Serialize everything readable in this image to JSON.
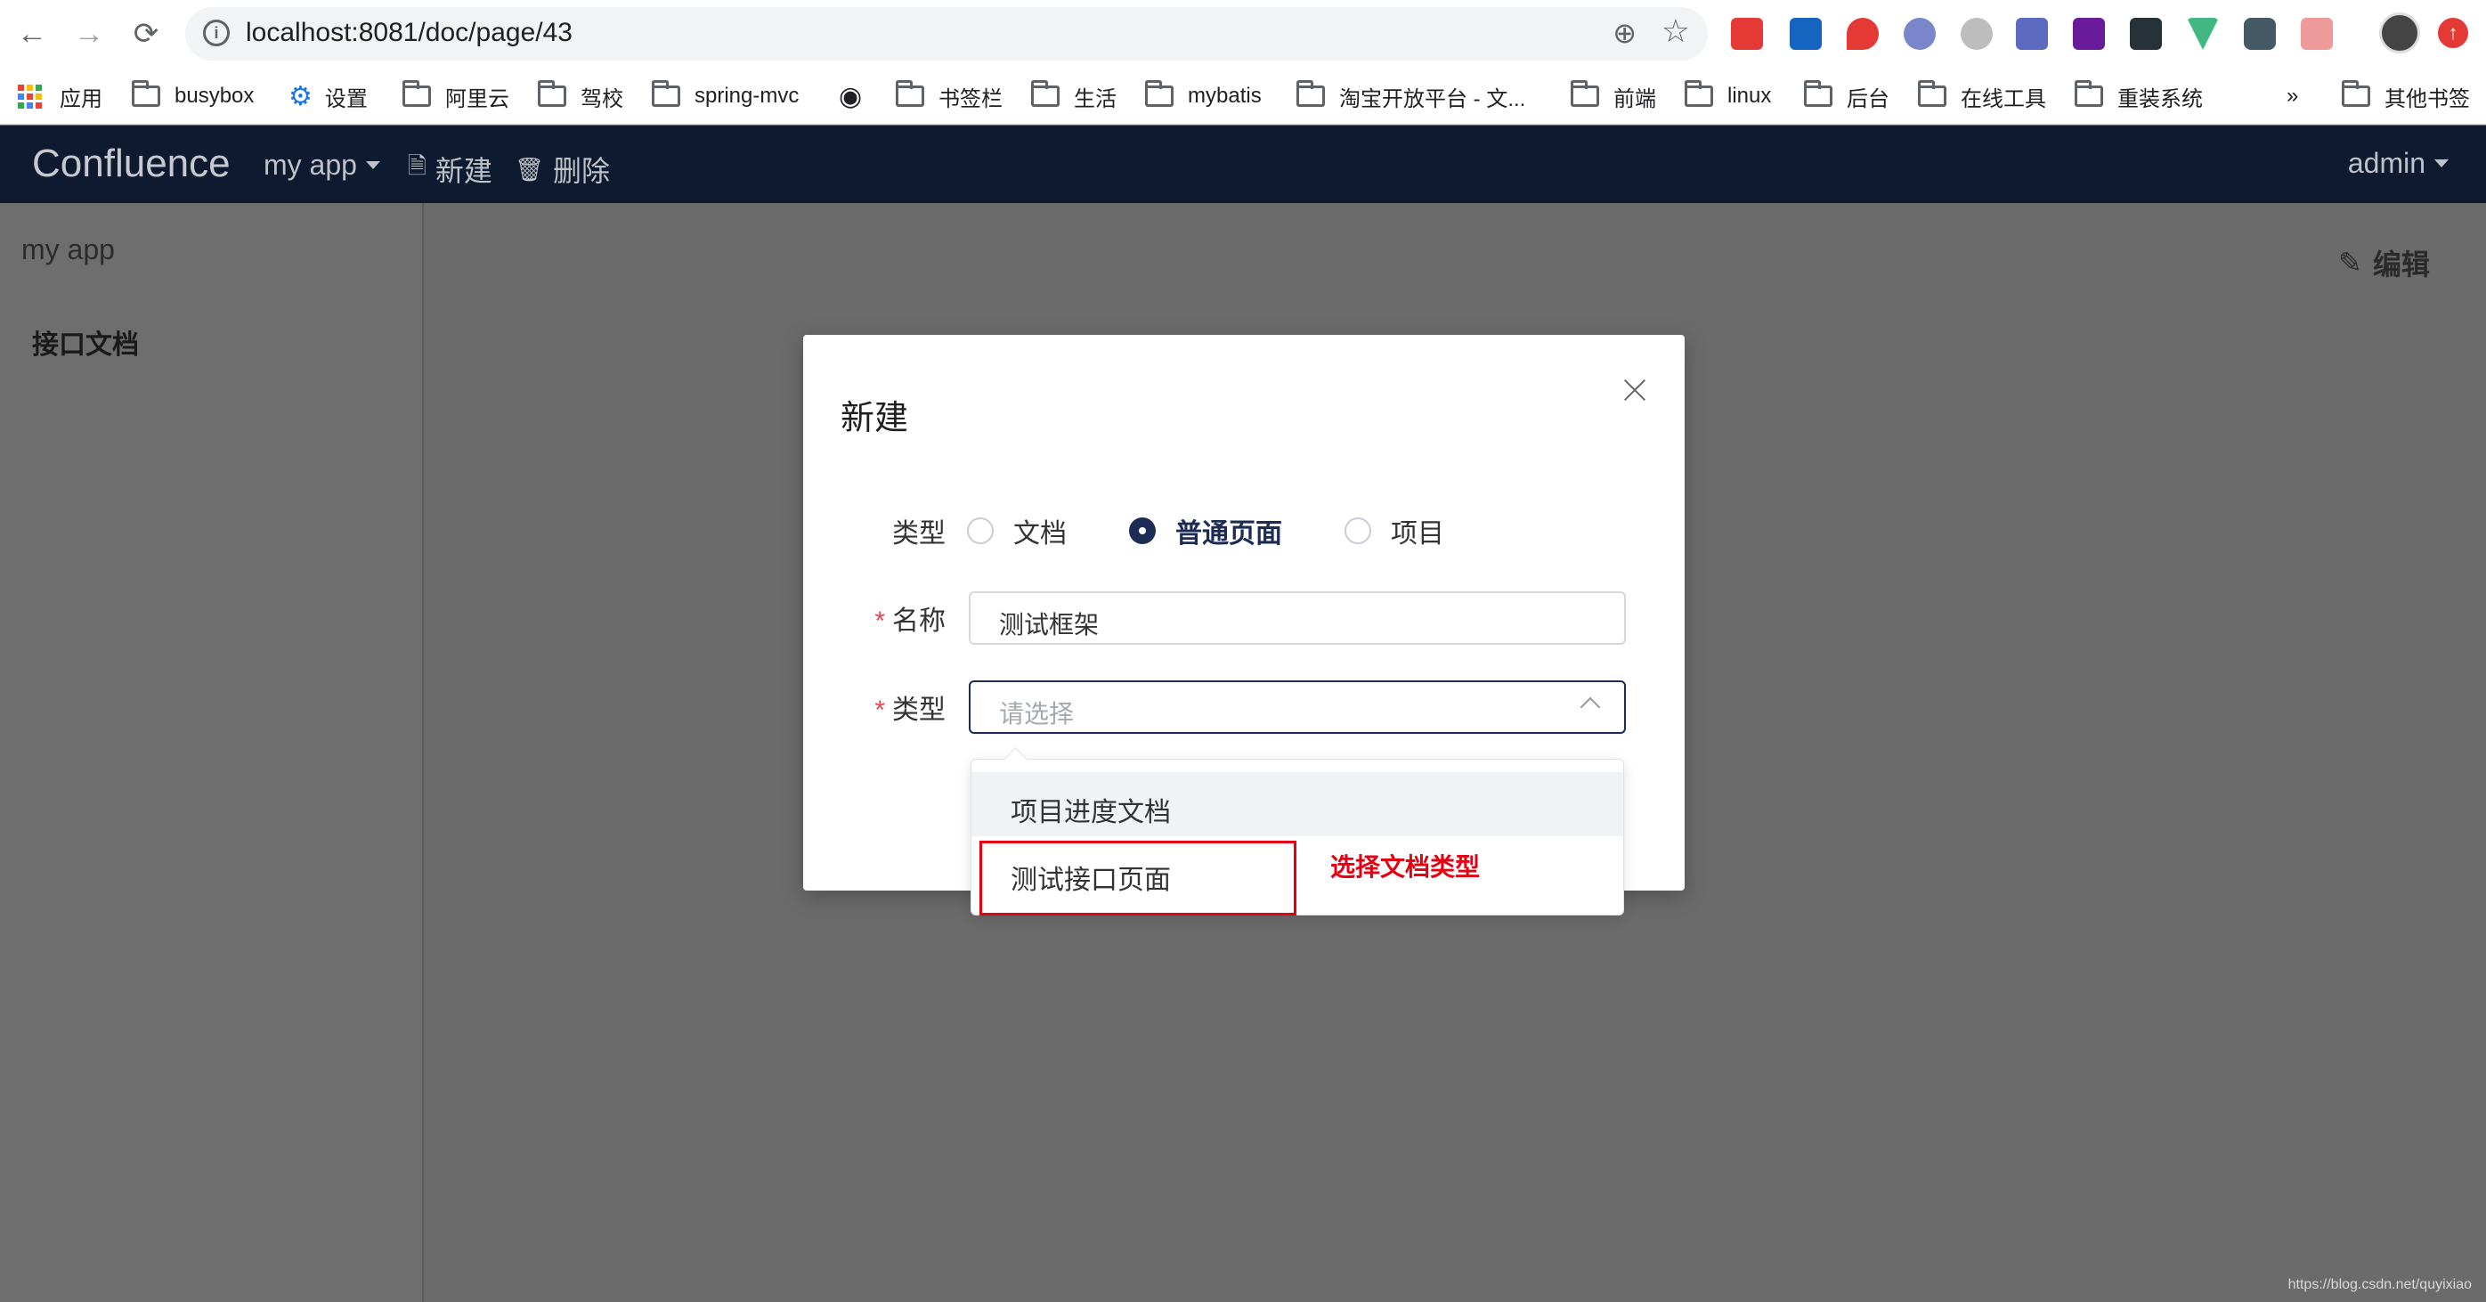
{
  "browser": {
    "url": "localhost:8081/doc/page/43",
    "bookmarks": [
      "应用",
      "busybox",
      "设置",
      "阿里云",
      "驾校",
      "spring-mvc",
      "书签栏",
      "生活",
      "mybatis",
      "淘宝开放平台 - 文...",
      "前端",
      "linux",
      "后台",
      "在线工具",
      "重装系统"
    ],
    "overflow": "»",
    "other_bookmarks": "其他书签"
  },
  "header": {
    "logo": "Confluence",
    "space": "my app",
    "new_label": "新建",
    "delete_label": "删除",
    "user": "admin"
  },
  "sidebar": {
    "title": "my app",
    "item": "接口文档"
  },
  "main": {
    "edit_label": "编辑",
    "watermark": "https://blog.csdn.net/quyixiao"
  },
  "modal": {
    "title": "新建",
    "type_label": "类型",
    "radios": [
      {
        "label": "文档",
        "checked": false
      },
      {
        "label": "普通页面",
        "checked": true
      },
      {
        "label": "项目",
        "checked": false
      }
    ],
    "name_label": "名称",
    "name_value": "测试框架",
    "select_label": "类型",
    "select_placeholder": "请选择"
  },
  "dropdown": {
    "options": [
      "项目进度文档",
      "测试接口页面"
    ]
  },
  "annotation": "选择文档类型",
  "colors": {
    "header_bg": "#0d1a30",
    "accent": "#1c2c55",
    "required": "#e8464c",
    "annotation": "#e60012"
  }
}
